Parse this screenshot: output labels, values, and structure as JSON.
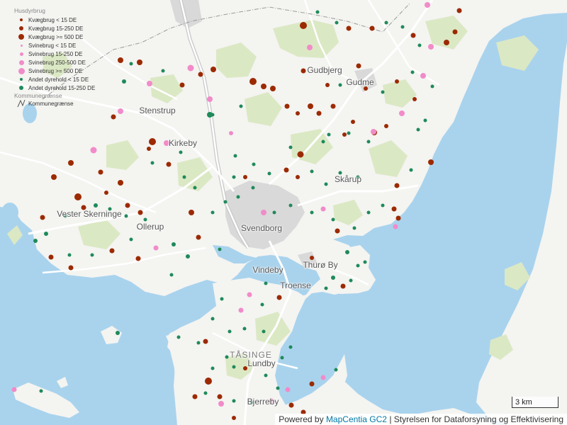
{
  "map": {
    "places": [
      {
        "name": "Gudbjerg"
      },
      {
        "name": "Gudme"
      },
      {
        "name": "Stenstrup"
      },
      {
        "name": "Kirkeby"
      },
      {
        "name": "Skårup"
      },
      {
        "name": "Vester Skerninge"
      },
      {
        "name": "Ollerup"
      },
      {
        "name": "Svendborg"
      },
      {
        "name": "Vindeby"
      },
      {
        "name": "Thurø By"
      },
      {
        "name": "Troense"
      },
      {
        "name": "TÅSINGE"
      },
      {
        "name": "Lundby"
      },
      {
        "name": "Bjerreby"
      }
    ]
  },
  "legend": {
    "title": "Husdyrbrug",
    "items": [
      {
        "label": "Kvægbrug < 15 DE",
        "color": "#9c2a00",
        "size": "small"
      },
      {
        "label": "Kvægbrug 15-250 DE",
        "color": "#9c2a00",
        "size": "medium"
      },
      {
        "label": "Kvægbrug >= 500 DE",
        "color": "#9c2a00",
        "size": "large"
      },
      {
        "label": "Svinebrug < 15 DE",
        "color": "#f18bc9",
        "size": "small"
      },
      {
        "label": "Svinebrug 15-250 DE",
        "color": "#f18bc9",
        "size": "medium"
      },
      {
        "label": "Svinebrug 250-500 DE",
        "color": "#f18bc9",
        "size": "large"
      },
      {
        "label": "Svinebrug >= 500 DE",
        "color": "#f18bc9",
        "size": "xlarge"
      },
      {
        "label": "Andet dyrehold < 15 DE",
        "color": "#1e8a5a",
        "size": "small"
      },
      {
        "label": "Andet dyrehold 15-250 DE",
        "color": "#1e8a5a",
        "size": "medium"
      }
    ],
    "title2": "Kommunegrænse",
    "boundary_label": "Kommunegrænse"
  },
  "scale": {
    "label": "3 km"
  },
  "attribution": {
    "prefix": "Powered by ",
    "link": "MapCentia GC2",
    "suffix": " | Styrelsen for Dataforsyning og Effektivisering"
  },
  "colors": {
    "water": "#a9d3ed",
    "land": "#f4f4f1",
    "green": "#dbe8c4",
    "urban": "#d9d9d9",
    "road": "#ffffff",
    "cattle": "#9c2a00",
    "pig": "#f18bc9",
    "other": "#1e8a5a"
  }
}
